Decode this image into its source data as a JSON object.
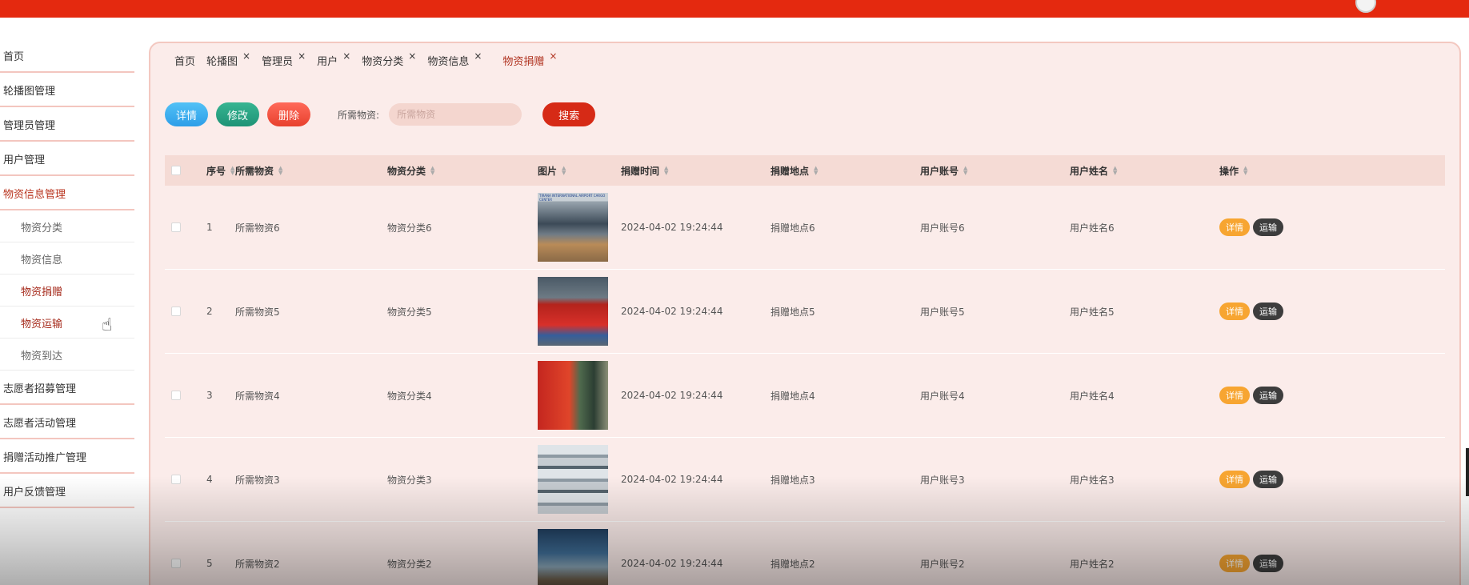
{
  "sidebar": {
    "items": [
      {
        "label": "首页"
      },
      {
        "label": "轮播图管理"
      },
      {
        "label": "管理员管理"
      },
      {
        "label": "用户管理"
      },
      {
        "label": "物资信息管理"
      }
    ],
    "sub_items": [
      {
        "label": "物资分类"
      },
      {
        "label": "物资信息"
      },
      {
        "label": "物资捐赠"
      },
      {
        "label": "物资运输"
      },
      {
        "label": "物资到达"
      }
    ],
    "more_items": [
      {
        "label": "志愿者招募管理"
      },
      {
        "label": "志愿者活动管理"
      },
      {
        "label": "捐赠活动推广管理"
      },
      {
        "label": "用户反馈管理"
      }
    ]
  },
  "tabs": {
    "home": "首页",
    "items": [
      {
        "label": "轮播图",
        "close": "×"
      },
      {
        "label": "管理员",
        "close": "×"
      },
      {
        "label": "用户",
        "close": "×"
      },
      {
        "label": "物资分类",
        "close": "×"
      },
      {
        "label": "物资信息",
        "close": "×"
      },
      {
        "label": "物资捐赠",
        "close": "×"
      }
    ]
  },
  "toolbar": {
    "detail_label": "详情",
    "edit_label": "修改",
    "delete_label": "删除",
    "search_label": "所需物资:",
    "search_placeholder": "所需物资",
    "search_button": "搜索"
  },
  "table": {
    "headers": {
      "index": "序号",
      "name": "所需物资",
      "category": "物资分类",
      "image": "图片",
      "time": "捐赠时间",
      "location": "捐赠地点",
      "account": "用户账号",
      "username": "用户姓名",
      "ops": "操作"
    },
    "rows": [
      {
        "index": "1",
        "name": "所需物资6",
        "category": "物资分类6",
        "time": "2024-04-02 19:24:44",
        "location": "捐赠地点6",
        "account": "用户账号6",
        "username": "用户姓名6",
        "thumb_text": "TIRANA INTERNATIONAL AIRPORT CARGO CENTER"
      },
      {
        "index": "2",
        "name": "所需物资5",
        "category": "物资分类5",
        "time": "2024-04-02 19:24:44",
        "location": "捐赠地点5",
        "account": "用户账号5",
        "username": "用户姓名5"
      },
      {
        "index": "3",
        "name": "所需物资4",
        "category": "物资分类4",
        "time": "2024-04-02 19:24:44",
        "location": "捐赠地点4",
        "account": "用户账号4",
        "username": "用户姓名4"
      },
      {
        "index": "4",
        "name": "所需物资3",
        "category": "物资分类3",
        "time": "2024-04-02 19:24:44",
        "location": "捐赠地点3",
        "account": "用户账号3",
        "username": "用户姓名3"
      },
      {
        "index": "5",
        "name": "所需物资2",
        "category": "物资分类2",
        "time": "2024-04-02 19:24:44",
        "location": "捐赠地点2",
        "account": "用户账号2",
        "username": "用户姓名2"
      }
    ],
    "op_detail": "详情",
    "op_ship": "运输"
  },
  "colors": {
    "topbar": "#e4290f",
    "accent": "#b8321c",
    "panel_bg": "#fbecea"
  }
}
